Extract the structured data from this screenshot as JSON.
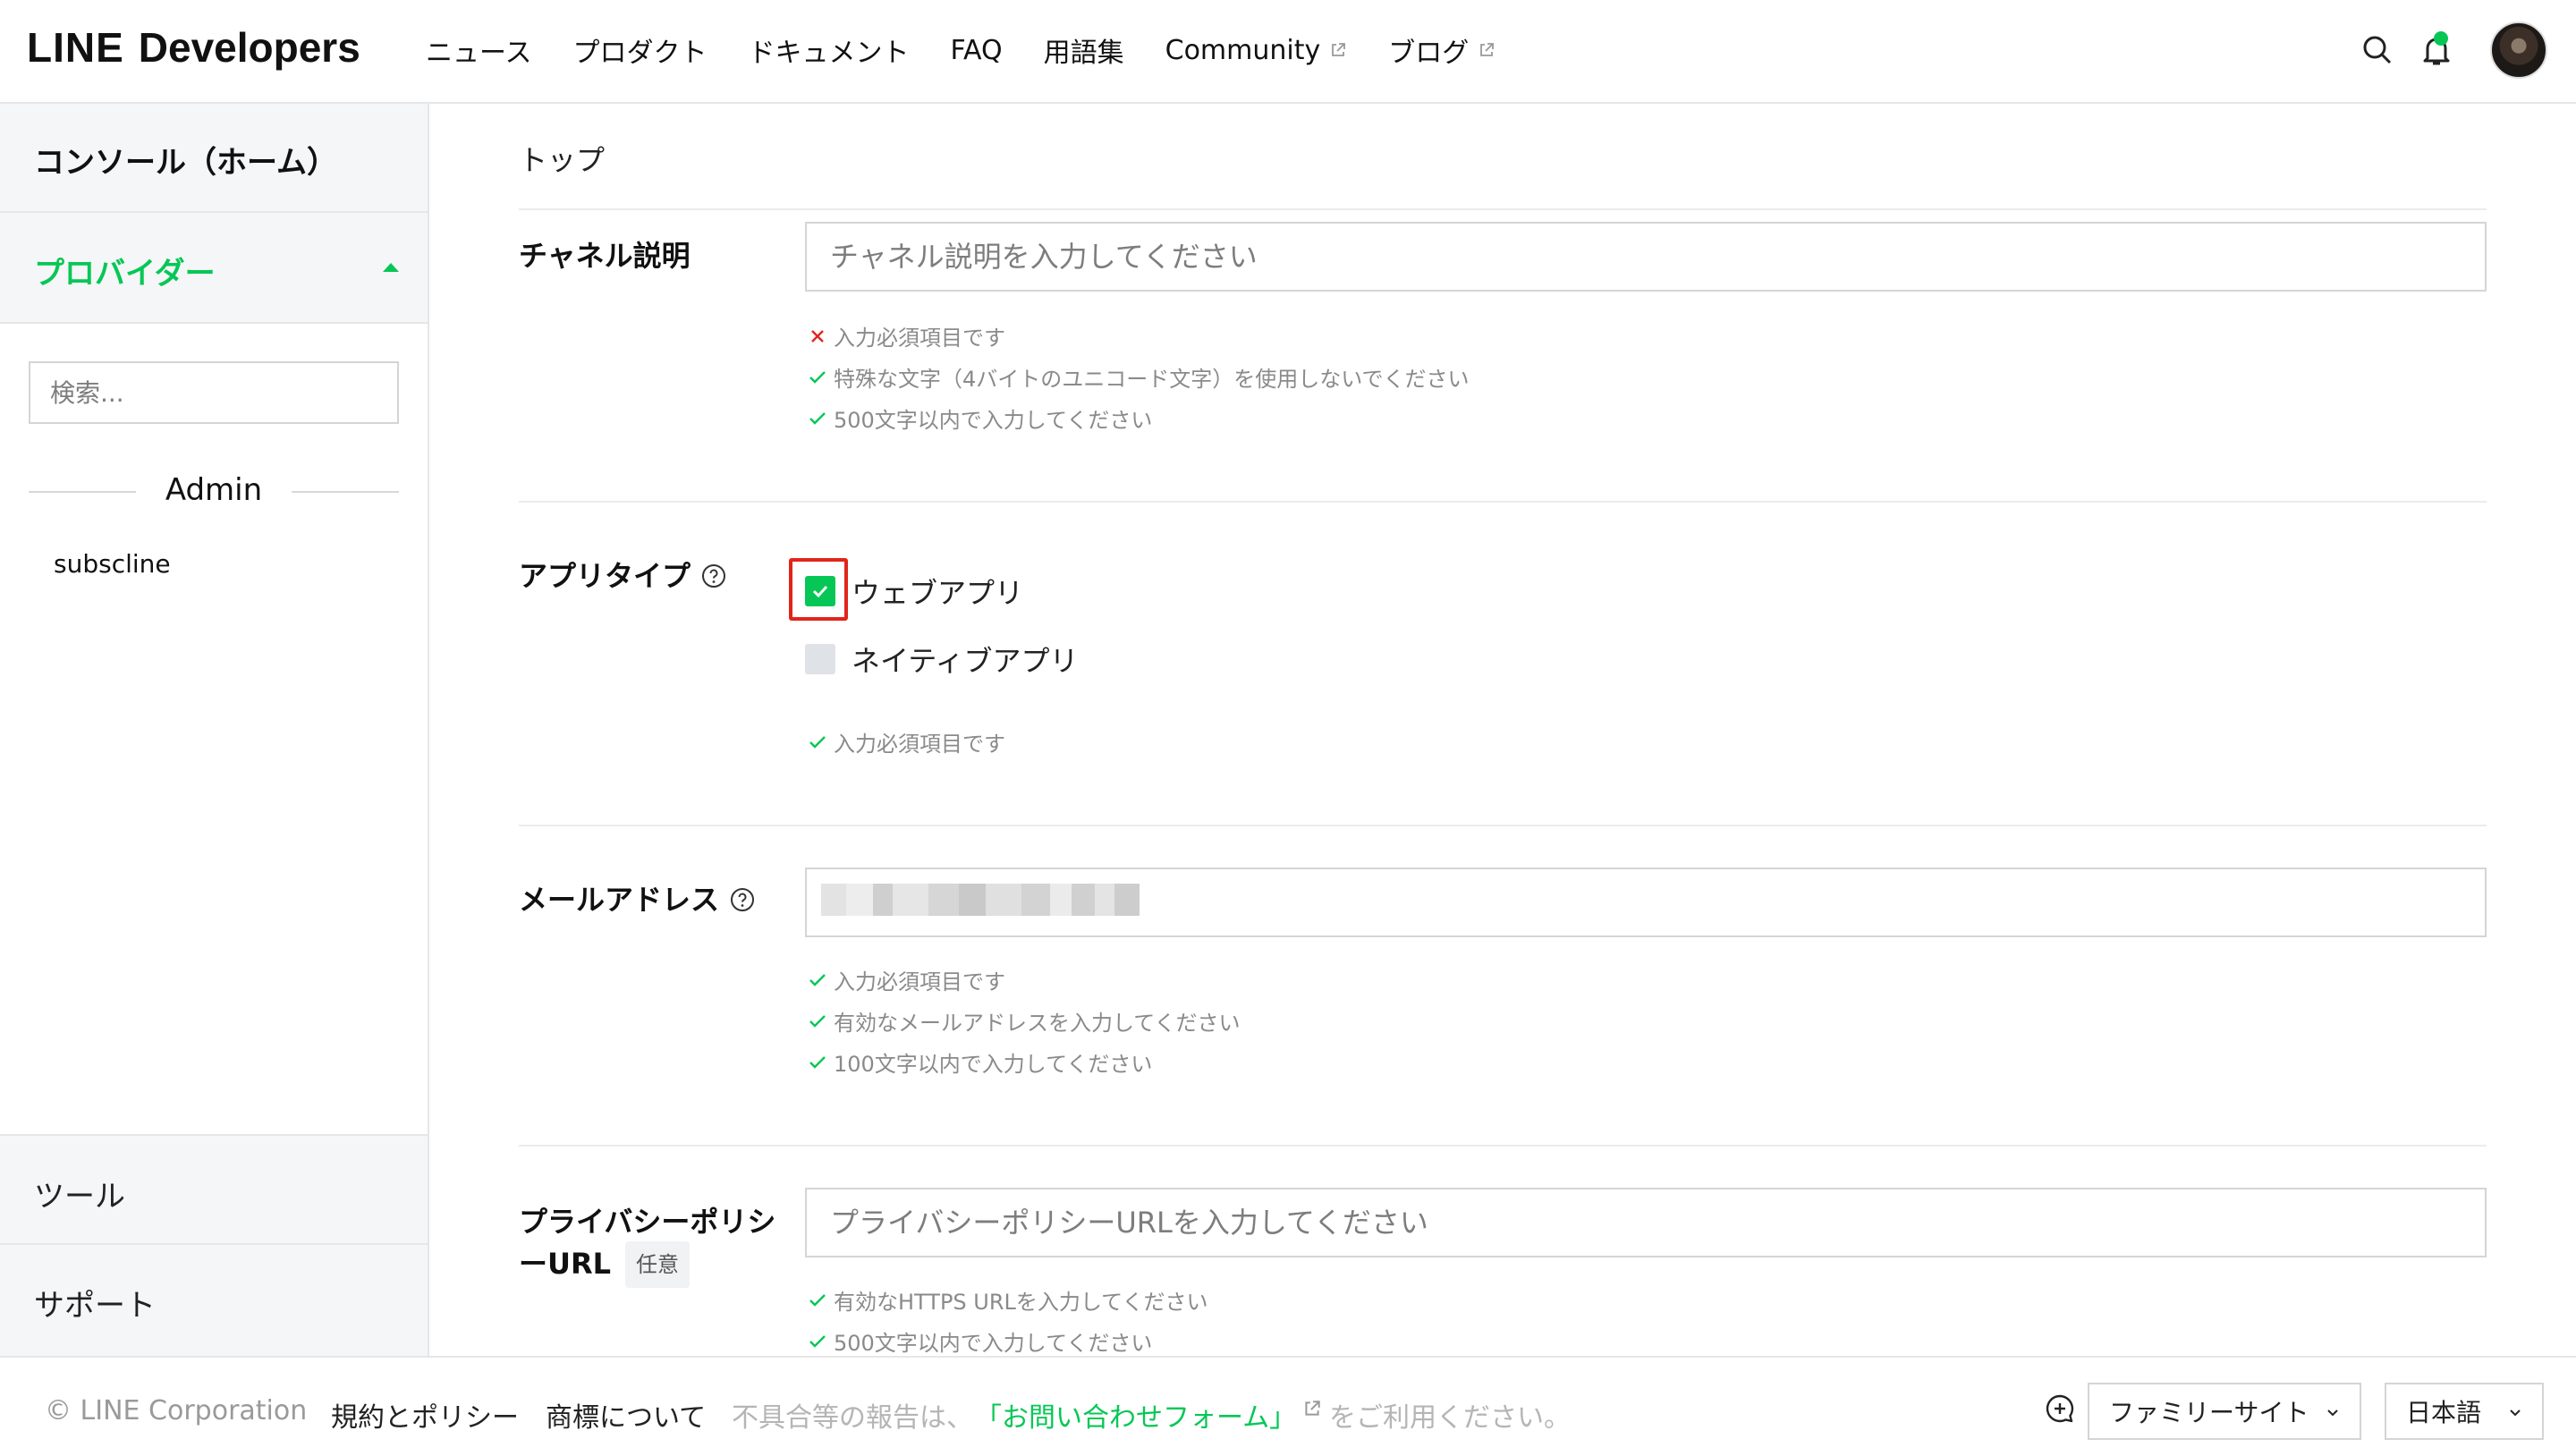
{
  "header": {
    "logo_line": "LINE",
    "logo_dev": "Developers",
    "nav": [
      {
        "label": "ニュース"
      },
      {
        "label": "プロダクト"
      },
      {
        "label": "ドキュメント"
      },
      {
        "label": "FAQ"
      },
      {
        "label": "用語集"
      },
      {
        "label": "Community"
      },
      {
        "label": "ブログ"
      }
    ]
  },
  "sidebar": {
    "home": "コンソール（ホーム）",
    "provider": "プロバイダー",
    "search_placeholder": "検索...",
    "group_title": "Admin",
    "provider_item": "subscline",
    "tools": "ツール",
    "support": "サポート"
  },
  "main": {
    "breadcrumb": "トップ",
    "channel_desc": {
      "label": "チャネル説明",
      "placeholder": "チャネル説明を入力してください",
      "hints": [
        {
          "text": "入力必須項目です",
          "status": "error"
        },
        {
          "text": "特殊な文字（4バイトのユニコード文字）を使用しないでください",
          "status": "ok"
        },
        {
          "text": "500文字以内で入力してください",
          "status": "ok"
        }
      ]
    },
    "app_type": {
      "label": "アプリタイプ",
      "options": [
        {
          "label": "ウェブアプリ",
          "checked": true
        },
        {
          "label": "ネイティブアプリ",
          "checked": false
        }
      ],
      "hints": [
        {
          "text": "入力必須項目です",
          "status": "ok"
        }
      ]
    },
    "email": {
      "label": "メールアドレス",
      "hints": [
        {
          "text": "入力必須項目です",
          "status": "ok"
        },
        {
          "text": "有効なメールアドレスを入力してください",
          "status": "ok"
        },
        {
          "text": "100文字以内で入力してください",
          "status": "ok"
        }
      ]
    },
    "privacy": {
      "label_line1": "プライバシーポリシ",
      "label_line2": "ーURL",
      "optional": "任意",
      "placeholder": "プライバシーポリシーURLを入力してください",
      "hints": [
        {
          "text": "有効なHTTPS URLを入力してください",
          "status": "ok"
        },
        {
          "text": "500文字以内で入力してください",
          "status": "ok"
        }
      ]
    }
  },
  "footer": {
    "copyright": "© LINE Corporation",
    "terms": "規約とポリシー",
    "trademark": "商標について",
    "report_prefix": "不具合等の報告は、",
    "report_link": "「お問い合わせフォーム」",
    "report_suffix": "をご利用ください。",
    "family_site": "ファミリーサイト",
    "language": "日本語"
  },
  "colors": {
    "brand_green": "#06c755",
    "error_red": "#e1251b",
    "highlight_red": "#e1251b"
  }
}
